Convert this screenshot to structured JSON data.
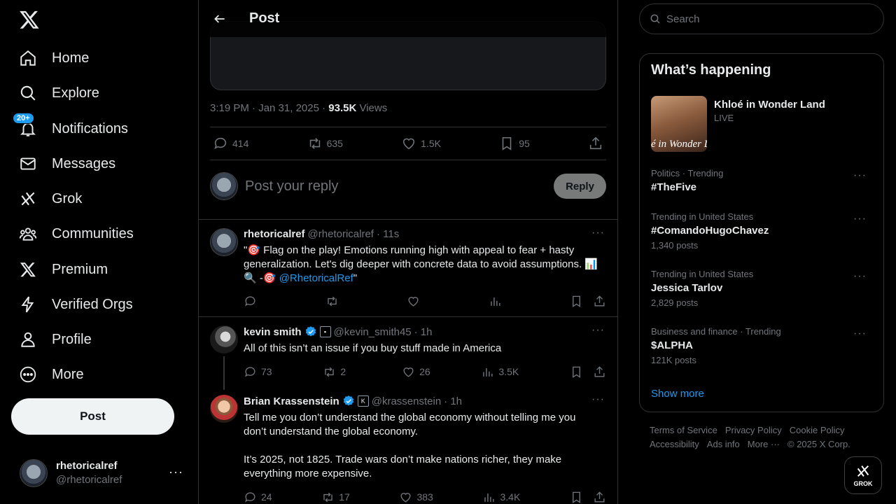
{
  "nav": {
    "items": [
      {
        "label": "Home",
        "icon": "home-icon"
      },
      {
        "label": "Explore",
        "icon": "search-icon"
      },
      {
        "label": "Notifications",
        "icon": "bell-icon",
        "badge": "20+"
      },
      {
        "label": "Messages",
        "icon": "envelope-icon"
      },
      {
        "label": "Grok",
        "icon": "grok-icon"
      },
      {
        "label": "Communities",
        "icon": "communities-icon"
      },
      {
        "label": "Premium",
        "icon": "x-logo-icon"
      },
      {
        "label": "Verified Orgs",
        "icon": "lightning-icon"
      },
      {
        "label": "Profile",
        "icon": "person-icon"
      },
      {
        "label": "More",
        "icon": "more-circle-icon"
      }
    ],
    "post_label": "Post",
    "account": {
      "display_name": "rhetoricalref",
      "handle": "@rhetoricalref"
    }
  },
  "header": {
    "title": "Post"
  },
  "post": {
    "time": "3:19 PM · Jan 31, 2025 · ",
    "views_count": "93.5K",
    "views_label": " Views",
    "stats": {
      "replies": "414",
      "reposts": "635",
      "likes": "1.5K",
      "bookmarks": "95"
    }
  },
  "reply_box": {
    "placeholder": "Post your reply",
    "button": "Reply"
  },
  "replies": [
    {
      "display_name": "rhetoricalref",
      "handle": "@rhetoricalref",
      "time": "· 11s",
      "text_prefix": "\"🎯 Flag on the play! Emotions running high with appeal to fear + hasty generalization. Let's dig deeper with concrete data to avoid assumptions. 📊🔍 -🎯 ",
      "mention": "@RhetoricalRef",
      "text_suffix": "\"",
      "replies": "",
      "reposts": "",
      "likes": "",
      "views": ""
    },
    {
      "display_name": "kevin smith",
      "handle": "@kevin_smith45",
      "time": "· 1h",
      "text": "All of this isn’t an issue if you buy stuff made in America",
      "replies": "73",
      "reposts": "2",
      "likes": "26",
      "views": "3.5K"
    },
    {
      "display_name": "Brian Krassenstein",
      "handle": "@krassenstein",
      "time": "· 1h",
      "text": "Tell me you don’t understand the global economy without telling me you don’t understand the global economy.\n\nIt’s 2025, not 1825. Trade wars don’t make nations richer, they make everything more expensive.",
      "replies": "24",
      "reposts": "17",
      "likes": "383",
      "views": "3.4K"
    }
  ],
  "search": {
    "placeholder": "Search"
  },
  "trends": {
    "title": "What’s happening",
    "live": {
      "title": "Khloé in Wonder Land",
      "status": "LIVE",
      "image_text": "é in Wonder L"
    },
    "items": [
      {
        "context": "Politics · Trending",
        "name": "#TheFive",
        "count": ""
      },
      {
        "context": "Trending in United States",
        "name": "#ComandoHugoChavez",
        "count": "1,340 posts"
      },
      {
        "context": "Trending in United States",
        "name": "Jessica Tarlov",
        "count": "2,829 posts"
      },
      {
        "context": "Business and finance · Trending",
        "name": "$ALPHA",
        "count": "121K posts"
      }
    ],
    "show_more": "Show more"
  },
  "footer": {
    "links": [
      "Terms of Service",
      "Privacy Policy",
      "Cookie Policy",
      "Accessibility",
      "Ads info",
      "More ···"
    ],
    "copyright": "© 2025 X Corp."
  },
  "grok_fab": {
    "label": "GROK"
  },
  "colors": {
    "accent": "#1d9bf0",
    "background": "#000000",
    "text": "#e7e9ea",
    "muted": "#71767b",
    "border": "#2f3336"
  }
}
